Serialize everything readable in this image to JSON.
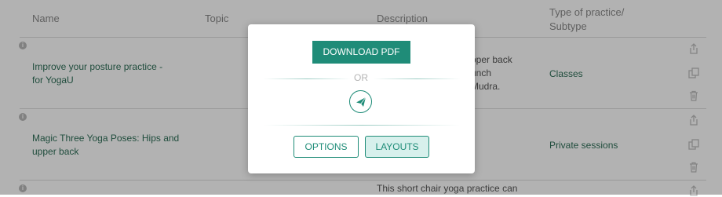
{
  "table": {
    "headers": {
      "name": "Name",
      "topic": "Topic",
      "description": "Description",
      "type_line1": "Type of practice/",
      "type_line2": "Subtype"
    },
    "rows": [
      {
        "name_line1": "Improve your posture practice -",
        "name_line2": "for YogaU",
        "desc_line1": "pper back",
        "desc_line2": "unch",
        "desc_line3": "Mudra.",
        "type": "Classes"
      },
      {
        "name_line1": "Magic Three Yoga Poses: Hips and",
        "name_line2": "upper back",
        "type": "Private sessions"
      },
      {
        "desc_line1": "This short chair yoga practice can"
      }
    ],
    "row_actions": [
      "share-icon",
      "duplicate-icon",
      "trash-icon"
    ]
  },
  "modal": {
    "download_label": "DOWNLOAD PDF",
    "or_label": "OR",
    "send_icon": "send-icon",
    "options_label": "OPTIONS",
    "layouts_label": "LAYOUTS"
  },
  "colors": {
    "accent": "#1f8c78",
    "accent_light": "#d7f0ec",
    "link_text": "#2f6f58"
  }
}
